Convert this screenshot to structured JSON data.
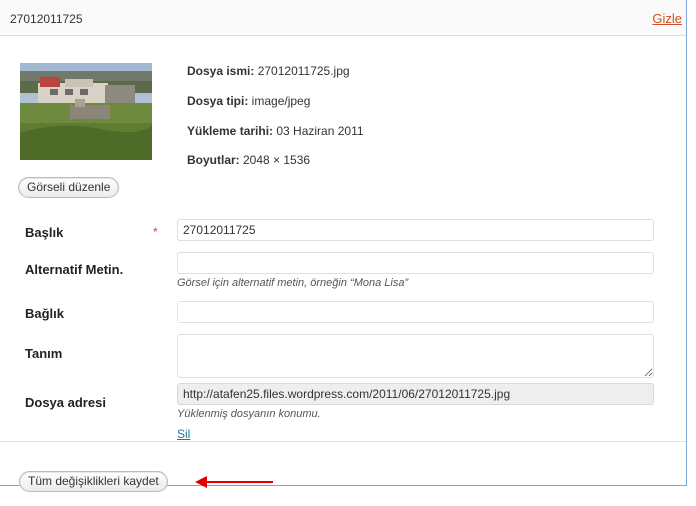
{
  "header": {
    "title": "27012011725",
    "hide_link": "Gizle"
  },
  "file_info": {
    "name_label": "Dosya ismi:",
    "name_value": " 27012011725.jpg",
    "type_label": "Dosya tipi:",
    "type_value": " image/jpeg",
    "date_label": "Yükleme tarihi:",
    "date_value": " 03 Haziran 2011",
    "size_label": "Boyutlar:",
    "size_value": " 2048 × 1536"
  },
  "edit_image_button": "Görseli düzenle",
  "form": {
    "title_label": "Başlık",
    "required_mark": "*",
    "title_value": "27012011725",
    "alt_label": "Alternatif Metin.",
    "alt_value": "",
    "alt_help": "Görsel için alternatif metin, örneğin “Mona Lisa”",
    "caption_label": "Bağlık",
    "caption_value": "",
    "description_label": "Tanım",
    "description_value": "",
    "url_label": "Dosya adresi",
    "url_value": "http://atafen25.files.wordpress.com/2011/06/27012011725.jpg",
    "url_help": "Yüklenmiş dosyanın konumu.",
    "delete_link": "Sil"
  },
  "save_button": "Tüm değişiklikleri kaydet",
  "colors": {
    "frame_border": "#7fa7d6",
    "hide_link": "#d54e21",
    "link": "#21759b",
    "arrow": "#e00000"
  }
}
